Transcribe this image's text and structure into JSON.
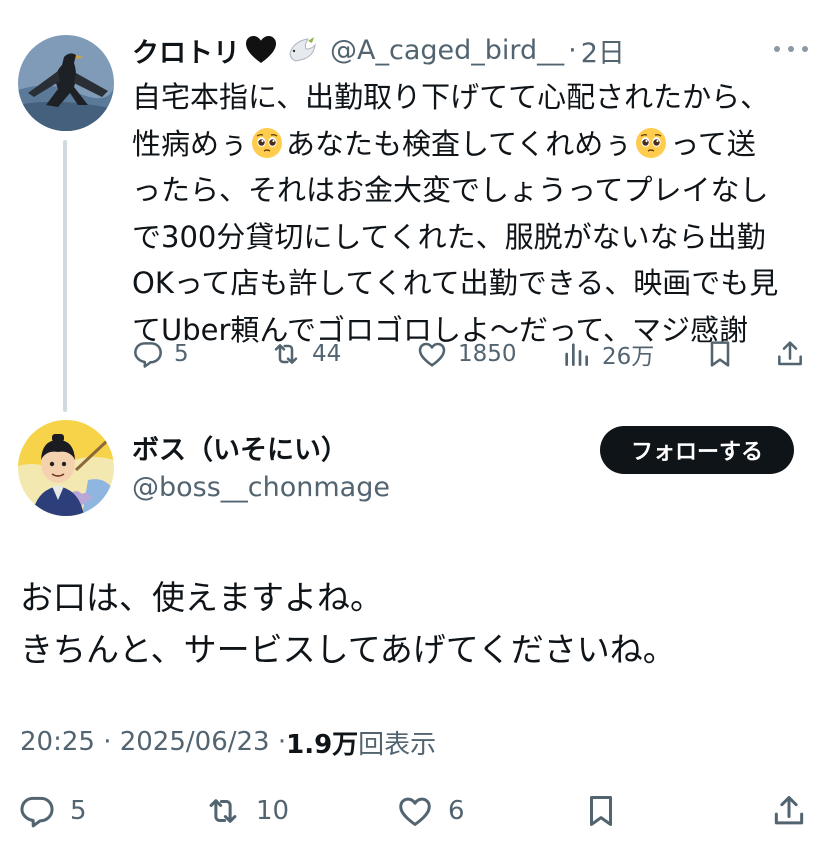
{
  "parent": {
    "display_name": "クロトリ",
    "handle": "@A_caged_bird__",
    "separator": "·",
    "time": "2日",
    "text_lines": [
      [
        "自宅本指に、出勤取り下げてて心配されたから、"
      ],
      [
        "性病めぅ",
        "あなたも検査してくれめぅ",
        "って送"
      ],
      [
        "ったら、それはお金大変でしょうってプレイなし"
      ],
      [
        "で300分貸切にしてくれた、服脱がないなら出勤"
      ],
      [
        "OKって店も許してくれて出勤できる、映画でも見"
      ],
      [
        "てUber頼んでゴロゴロしよ〜だって、マジ感謝"
      ]
    ],
    "actions": {
      "replies": "5",
      "retweets": "44",
      "likes": "1850",
      "views": "26万"
    }
  },
  "reply": {
    "display_name": "ボス（いそにい）",
    "handle": "@boss__chonmage",
    "follow_label": "フォローする",
    "text_lines": [
      "お口は、使えますよね。",
      "きちんと、サービスしてあげてくださいね。"
    ],
    "timestamp": "20:25 · 2025/06/23 · ",
    "views_count": "1.9万",
    "views_label": "回表示",
    "actions": {
      "replies": "5",
      "retweets": "10",
      "likes": "6"
    }
  },
  "colors": {
    "text": "#0f1419",
    "muted": "#536471",
    "thread_line": "#cfd9de",
    "follow_bg": "#0f1419"
  },
  "icons": [
    "black-heart-icon",
    "dove-icon",
    "pleading-face-icon",
    "more-icon",
    "reply-icon",
    "retweet-icon",
    "like-icon",
    "views-icon",
    "bookmark-icon",
    "share-icon"
  ]
}
